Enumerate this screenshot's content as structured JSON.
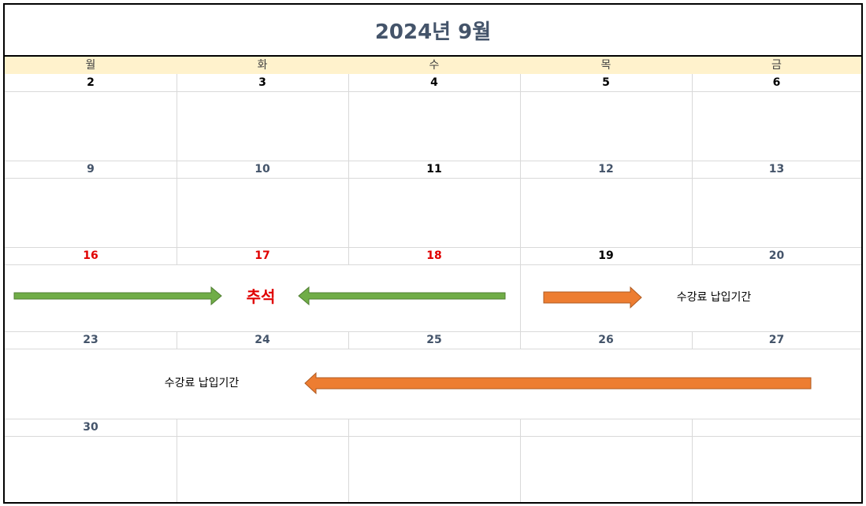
{
  "calendar": {
    "title": "2024년 9월",
    "weekdays": [
      "월",
      "화",
      "수",
      "목",
      "금"
    ],
    "weeks": [
      [
        {
          "d": "2",
          "c": "dark"
        },
        {
          "d": "3",
          "c": "dark"
        },
        {
          "d": "4",
          "c": "dark"
        },
        {
          "d": "5",
          "c": "dark"
        },
        {
          "d": "6",
          "c": "dark"
        }
      ],
      [
        {
          "d": "9",
          "c": "slate"
        },
        {
          "d": "10",
          "c": "slate"
        },
        {
          "d": "11",
          "c": "dark"
        },
        {
          "d": "12",
          "c": "slate"
        },
        {
          "d": "13",
          "c": "slate"
        }
      ],
      [
        {
          "d": "16",
          "c": "red"
        },
        {
          "d": "17",
          "c": "red"
        },
        {
          "d": "18",
          "c": "red"
        },
        {
          "d": "19",
          "c": "dark"
        },
        {
          "d": "20",
          "c": "slate"
        }
      ],
      [
        {
          "d": "23",
          "c": "slate"
        },
        {
          "d": "24",
          "c": "slate"
        },
        {
          "d": "25",
          "c": "slate"
        },
        {
          "d": "26",
          "c": "slate"
        },
        {
          "d": "27",
          "c": "slate"
        }
      ],
      [
        {
          "d": "30",
          "c": "slate"
        },
        {
          "d": "",
          "c": "slate"
        },
        {
          "d": "",
          "c": "slate"
        },
        {
          "d": "",
          "c": "slate"
        },
        {
          "d": "",
          "c": "slate"
        }
      ]
    ]
  },
  "annotations": {
    "holiday_label": "추석",
    "tuition_label_week3": "수강료 납입기간",
    "tuition_label_week4": "수강료 납입기간"
  },
  "colors": {
    "green_arrow": "#70ad47",
    "orange_arrow": "#ed7d31",
    "header_fill": "#fff2cc",
    "red_date": "#e00000"
  }
}
